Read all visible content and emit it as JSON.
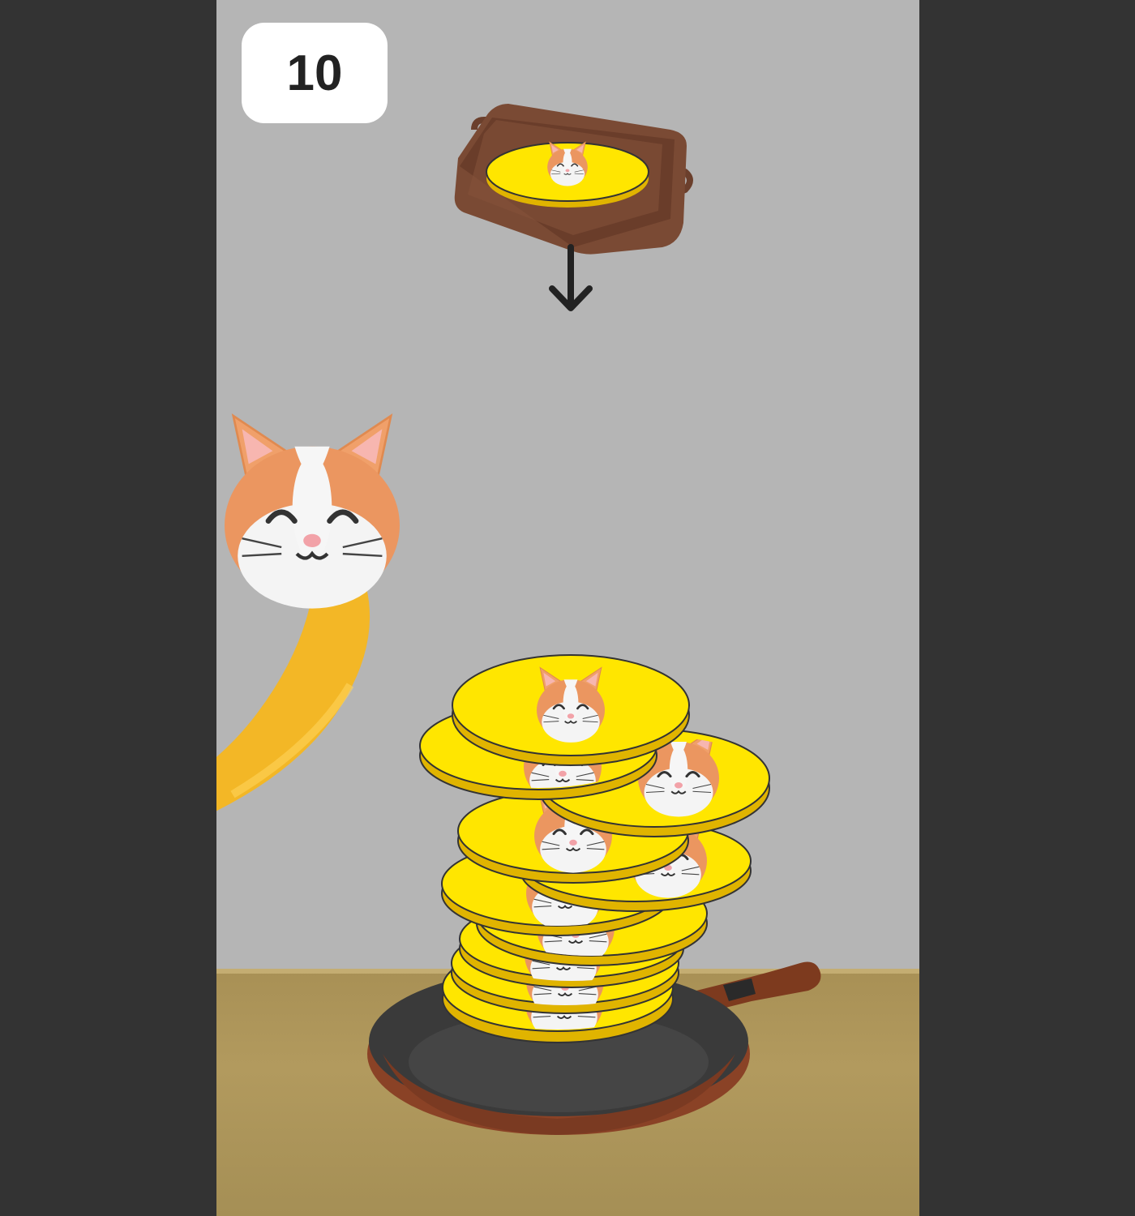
{
  "score": "10",
  "dropper": {
    "icon": "baking-tray-icon",
    "hint_icon": "down-arrow-icon"
  },
  "stack": {
    "coin_count": 10,
    "coin_face": "hamster-face"
  },
  "colors": {
    "background": "#b5b5b5",
    "outer": "#333333",
    "coin": "#ffe600",
    "coin_edge": "#e0b400",
    "tray": "#7a4a34",
    "pan": "#3d3d3d",
    "pan_rim": "#8a4226",
    "handle": "#7d3a1e",
    "banana": "#f3b726"
  }
}
